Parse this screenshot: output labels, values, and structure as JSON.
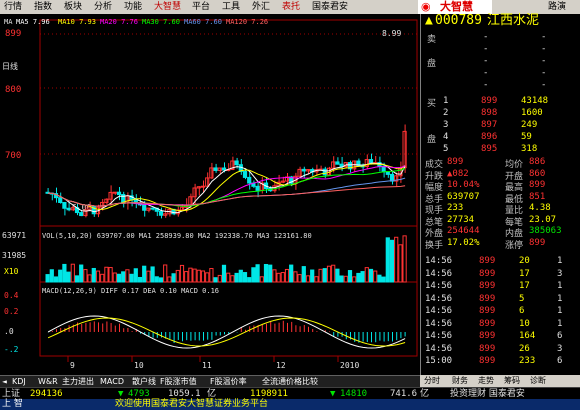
{
  "menu": [
    "行情",
    "指数",
    "板块",
    "分析",
    "功能",
    "大智慧",
    "平台",
    "工具",
    "外汇",
    "表托",
    "国泰君安"
  ],
  "menu_highlight": [
    5,
    9
  ],
  "right_menu": "路演",
  "brand": "大智慧",
  "ma_line": {
    "ma": "MA",
    "ma5": "MA5 7.96",
    "ma10": "MA10 7.93",
    "ma20": "MA20 7.76",
    "ma30": "MA30 7.60",
    "ma60": "MA60 7.60",
    "ma120": "MA120 7.26"
  },
  "price_axis": {
    "p899": "899",
    "p800": "800",
    "p700": "700",
    "max_label": "8.99",
    "min_label": "6.00",
    "left_tag": "日线"
  },
  "vol_line": "VOL(5,10,20)  639707.00  MA1 258939.80  MA2 192338.70  MA3 123161.80",
  "vol_axis": {
    "v1": "63971",
    "v2": "31985",
    "v3": "X10"
  },
  "macd_line": "MACD(12,26,9)  DIFF 0.17  DEA 0.10  MACD 0.16",
  "macd_axis": {
    "a1": "0.4",
    "a2": "0.2",
    "a3": ".0",
    "a4": "-.2"
  },
  "date_axis": [
    "9",
    "10",
    "11",
    "12",
    "2010"
  ],
  "bottom_tabs": [
    "KDJ",
    "W&R",
    "主力进出",
    "MACD",
    "散户线",
    "F股涨市值",
    "F股温价率",
    "全流通价格比较"
  ],
  "right_tabs": [
    "分时",
    "财务",
    "走势",
    "筹码",
    "诊断"
  ],
  "stock": {
    "code": "000789",
    "name": "江西水泥"
  },
  "ask": [
    {
      "label": "卖",
      "price": "-",
      "vol": "-"
    },
    {
      "label": "",
      "price": "-",
      "vol": "-"
    },
    {
      "label": "盘",
      "price": "-",
      "vol": "-"
    },
    {
      "label": "",
      "price": "-",
      "vol": "-"
    },
    {
      "label": "",
      "price": "-",
      "vol": "-"
    }
  ],
  "bid": [
    {
      "label": "买",
      "n": "1",
      "price": "899",
      "vol": "43148"
    },
    {
      "label": "",
      "n": "2",
      "price": "898",
      "vol": "1600"
    },
    {
      "label": "",
      "n": "3",
      "price": "897",
      "vol": "249"
    },
    {
      "label": "盘",
      "n": "4",
      "price": "896",
      "vol": "59"
    },
    {
      "label": "",
      "n": "5",
      "price": "895",
      "vol": "318"
    }
  ],
  "stats": [
    {
      "l1": "成交",
      "v1": "899",
      "l2": "均价",
      "v2": "886"
    },
    {
      "l1": "升跌",
      "v1": "▲082",
      "l2": "开盘",
      "v2": "860"
    },
    {
      "l1": "幅度",
      "v1": "10.04%",
      "l2": "最高",
      "v2": "899"
    },
    {
      "l1": "总手",
      "v1": "639707",
      "l2": "最低",
      "v2": "851"
    },
    {
      "l1": "现手",
      "v1": "233",
      "l2": "量比",
      "v2": "4.38"
    },
    {
      "l1": "总笔",
      "v1": "27734",
      "l2": "每笔",
      "v2": "23.07"
    },
    {
      "l1": "外盘",
      "v1": "254644",
      "l2": "内盘",
      "v2": "385063"
    },
    {
      "l1": "换手",
      "v1": "17.02%",
      "l2": "涨停",
      "v2": "899"
    }
  ],
  "ticks": [
    {
      "time": "14:56",
      "price": "899",
      "vol": "20",
      "n": "1"
    },
    {
      "time": "14:56",
      "price": "899",
      "vol": "17",
      "n": "3"
    },
    {
      "time": "14:56",
      "price": "899",
      "vol": "17",
      "n": "1"
    },
    {
      "time": "14:56",
      "price": "899",
      "vol": "5",
      "n": "1"
    },
    {
      "time": "14:56",
      "price": "899",
      "vol": "6",
      "n": "1"
    },
    {
      "time": "14:56",
      "price": "899",
      "vol": "10",
      "n": "1"
    },
    {
      "time": "14:56",
      "price": "899",
      "vol": "164",
      "n": "6"
    },
    {
      "time": "14:56",
      "price": "899",
      "vol": "26",
      "n": "3"
    },
    {
      "time": "15:00",
      "price": "899",
      "vol": "233",
      "n": "6"
    }
  ],
  "status": {
    "index": "上证",
    "v1": "294136",
    "v2": "4793",
    "v3": "1059.1",
    "v3b": "亿",
    "v4": "1198911",
    "v5": "14810",
    "v6": "741.6",
    "v6b": "亿"
  },
  "status_right": "投资理财 国泰君安",
  "ticker": "欢迎使用国泰君安大智慧证券业务平台",
  "ticker_left": "上  智",
  "colors": {
    "up": "#ff3232",
    "down": "#00e6e6",
    "bg": "#000000",
    "ma5": "#ffffff",
    "ma10": "#ffff00",
    "ma20": "#ff00ff",
    "ma30": "#00ff00",
    "ma60": "#6495ed",
    "ma120": "#ff6060"
  }
}
